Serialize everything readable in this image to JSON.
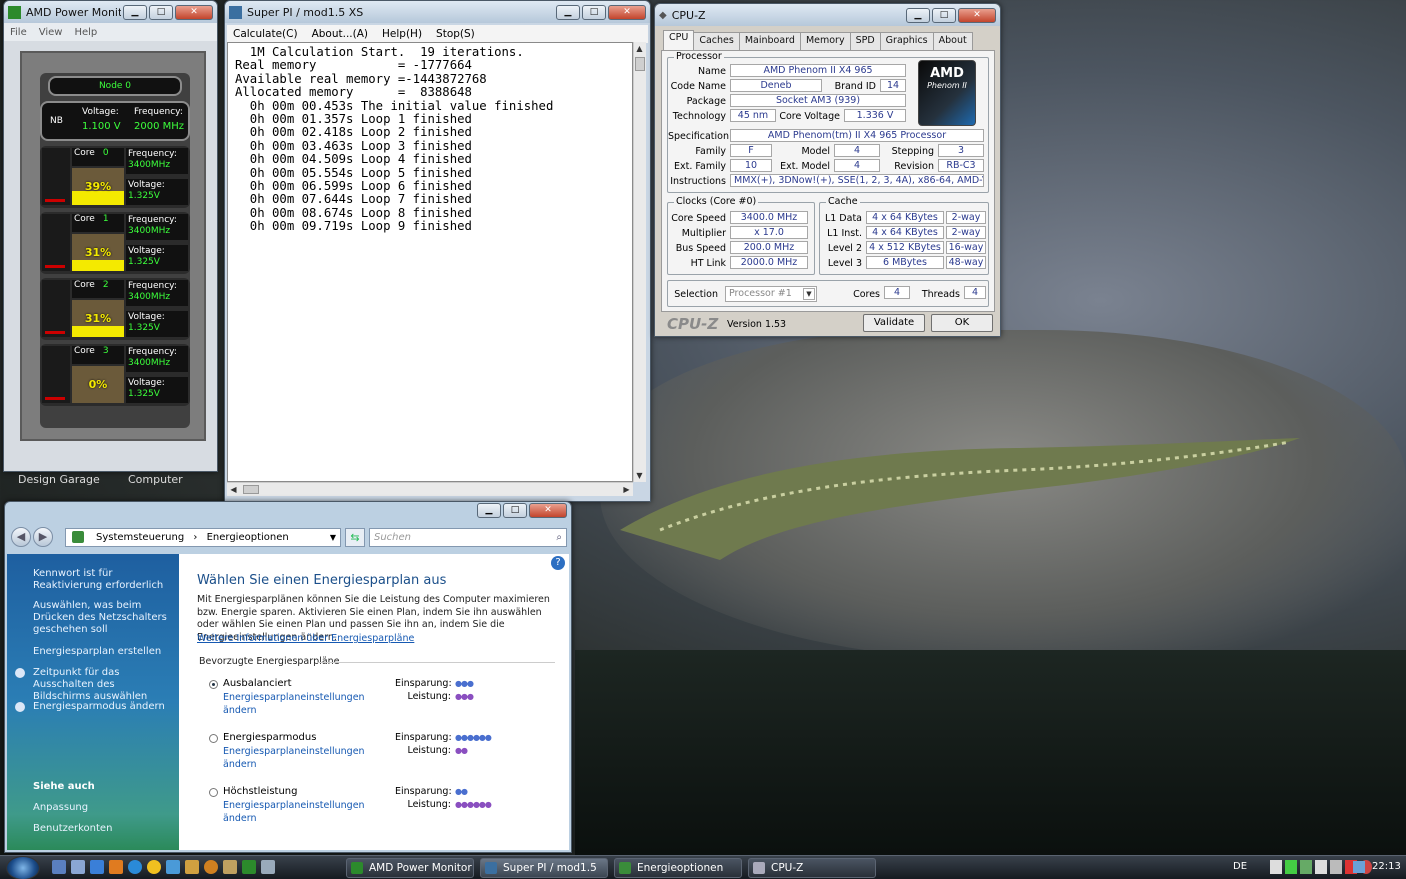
{
  "amd_power_monitor": {
    "title": "AMD Power Monitor",
    "menu": [
      "File",
      "View",
      "Help"
    ],
    "node_label": "Node 0",
    "nb": {
      "label": "NB",
      "voltage_label": "Voltage:",
      "voltage": "1.100 V",
      "frequency_label": "Frequency:",
      "frequency": "2000 MHz"
    },
    "core_label": "Core",
    "frequency_label": "Frequency:",
    "voltage_label": "Voltage:",
    "cores": [
      {
        "index": "0",
        "usage": "39%",
        "usage_pct": 39,
        "frequency": "3400MHz",
        "voltage": "1.325V"
      },
      {
        "index": "1",
        "usage": "31%",
        "usage_pct": 31,
        "frequency": "3400MHz",
        "voltage": "1.325V"
      },
      {
        "index": "2",
        "usage": "31%",
        "usage_pct": 31,
        "frequency": "3400MHz",
        "voltage": "1.325V"
      },
      {
        "index": "3",
        "usage": "0%",
        "usage_pct": 0,
        "frequency": "3400MHz",
        "voltage": "1.325V"
      }
    ]
  },
  "desktop_labels": [
    "Design Garage",
    "Computer"
  ],
  "superpi": {
    "title": "Super PI / mod1.5 XS",
    "menu": [
      "Calculate(C)",
      "About...(A)",
      "Help(H)",
      "Stop(S)"
    ],
    "lines": [
      "  1M Calculation Start.  19 iterations.",
      "Real memory           = -1777664",
      "Available real memory =-1443872768",
      "Allocated memory      =  8388648",
      "  0h 00m 00.453s The initial value finished",
      "  0h 00m 01.357s Loop 1 finished",
      "  0h 00m 02.418s Loop 2 finished",
      "  0h 00m 03.463s Loop 3 finished",
      "  0h 00m 04.509s Loop 4 finished",
      "  0h 00m 05.554s Loop 5 finished",
      "  0h 00m 06.599s Loop 6 finished",
      "  0h 00m 07.644s Loop 7 finished",
      "  0h 00m 08.674s Loop 8 finished",
      "  0h 00m 09.719s Loop 9 finished"
    ]
  },
  "cpuz": {
    "title": "CPU-Z",
    "tabs": [
      "CPU",
      "Caches",
      "Mainboard",
      "Memory",
      "SPD",
      "Graphics",
      "About"
    ],
    "processor_group": "Processor",
    "name_label": "Name",
    "name": "AMD Phenom II X4 965",
    "codename_label": "Code Name",
    "codename": "Deneb",
    "brandid_label": "Brand ID",
    "brandid": "14",
    "package_label": "Package",
    "package": "Socket AM3 (939)",
    "technology_label": "Technology",
    "technology": "45 nm",
    "corevoltage_label": "Core Voltage",
    "corevoltage": "1.336 V",
    "spec_label": "Specification",
    "spec": "AMD Phenom(tm) II X4 965 Processor",
    "family_label": "Family",
    "family": "F",
    "model_label": "Model",
    "model": "4",
    "stepping_label": "Stepping",
    "stepping": "3",
    "extfamily_label": "Ext. Family",
    "extfamily": "10",
    "extmodel_label": "Ext. Model",
    "extmodel": "4",
    "revision_label": "Revision",
    "revision": "RB-C3",
    "instructions_label": "Instructions",
    "instructions": "MMX(+), 3DNow!(+), SSE(1, 2, 3, 4A), x86-64, AMD-V",
    "clocks_group": "Clocks (Core #0)",
    "corespeed_label": "Core Speed",
    "corespeed": "3400.0 MHz",
    "multiplier_label": "Multiplier",
    "multiplier": "x 17.0",
    "busspeed_label": "Bus Speed",
    "busspeed": "200.0 MHz",
    "htlink_label": "HT Link",
    "htlink": "2000.0 MHz",
    "cache_group": "Cache",
    "cache": [
      {
        "label": "L1 Data",
        "size": "4 x 64 KBytes",
        "way": "2-way"
      },
      {
        "label": "L1 Inst.",
        "size": "4 x 64 KBytes",
        "way": "2-way"
      },
      {
        "label": "Level 2",
        "size": "4 x 512 KBytes",
        "way": "16-way"
      },
      {
        "label": "Level 3",
        "size": "6 MBytes",
        "way": "48-way"
      }
    ],
    "selection_label": "Selection",
    "selection": "Processor #1",
    "cores_label": "Cores",
    "cores": "4",
    "threads_label": "Threads",
    "threads": "4",
    "brand": "CPU-Z",
    "version": "Version 1.53",
    "validate": "Validate",
    "ok": "OK",
    "logo_line1": "AMD",
    "logo_line2": "Phenom II"
  },
  "explorer": {
    "breadcrumb": [
      "Systemsteuerung",
      "Energieoptionen"
    ],
    "search_placeholder": "Suchen",
    "sidebar_links": [
      "Kennwort ist für Reaktivierung erforderlich",
      "Auswählen, was beim Drücken des Netzschalters geschehen soll",
      "Energiesparplan erstellen",
      "Zeitpunkt für das Ausschalten des Bildschirms auswählen",
      "Energiesparmodus ändern"
    ],
    "see_also_title": "Siehe auch",
    "see_also": [
      "Anpassung",
      "Benutzerkonten"
    ],
    "heading": "Wählen Sie einen Energiesparplan aus",
    "intro": "Mit Energiesparplänen können Sie die Leistung des Computer maximieren bzw. Energie sparen. Aktivieren Sie einen Plan, indem Sie ihn auswählen oder wählen Sie einen Plan und passen Sie ihn an, indem Sie die Energieeinstellungen ändern.",
    "more_info": "Weitere Informationen über Energiesparpläne",
    "preferred": "Bevorzugte Energiesparpläne",
    "savings_label": "Einsparung:",
    "performance_label": "Leistung:",
    "plans": [
      {
        "name": "Ausbalanciert",
        "link": "Energiesparplaneinstellungen ändern",
        "savings": "●●●",
        "performance": "●●●",
        "selected": true
      },
      {
        "name": "Energiesparmodus",
        "link": "Energiesparplaneinstellungen ändern",
        "savings": "●●●●●●",
        "performance": "●●",
        "selected": false
      },
      {
        "name": "Höchstleistung",
        "link": "Energiesparplaneinstellungen ändern",
        "savings": "●●",
        "performance": "●●●●●●",
        "selected": false
      }
    ]
  },
  "taskbar": {
    "buttons": [
      "AMD Power Monitor",
      "Super PI / mod1.5 XS",
      "Energieoptionen",
      "CPU-Z"
    ],
    "language": "DE",
    "clock": "22:13"
  },
  "colors": {
    "accent_green": "#3cff3c",
    "usage_yellow": "#f4ea00",
    "cpuz_value": "#2b3a8f",
    "link": "#1659b2"
  }
}
